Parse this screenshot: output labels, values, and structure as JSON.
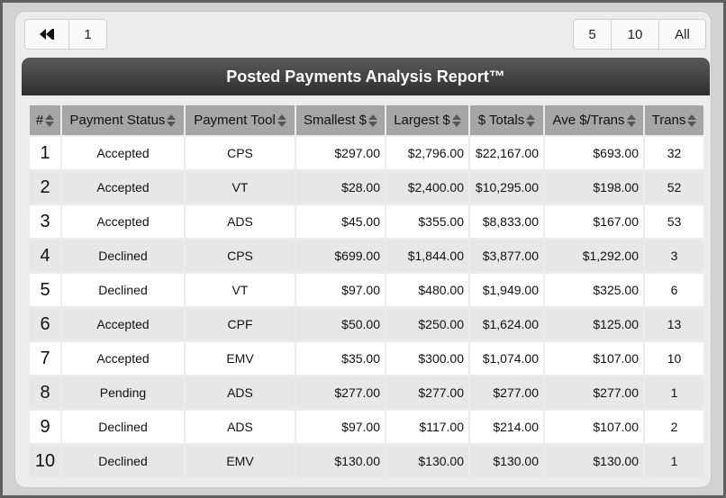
{
  "pager": {
    "first_label": "",
    "page_label": "1",
    "sizes": [
      "5",
      "10",
      "All"
    ]
  },
  "report": {
    "title": "Posted Payments Analysis Report™"
  },
  "table": {
    "columns": [
      "#",
      "Payment Status",
      "Payment Tool",
      "Smallest $",
      "Largest $",
      "$ Totals",
      "Ave $/Trans",
      "Trans"
    ],
    "rows": [
      [
        "1",
        "Accepted",
        "CPS",
        "$297.00",
        "$2,796.00",
        "$22,167.00",
        "$693.00",
        "32"
      ],
      [
        "2",
        "Accepted",
        "VT",
        "$28.00",
        "$2,400.00",
        "$10,295.00",
        "$198.00",
        "52"
      ],
      [
        "3",
        "Accepted",
        "ADS",
        "$45.00",
        "$355.00",
        "$8,833.00",
        "$167.00",
        "53"
      ],
      [
        "4",
        "Declined",
        "CPS",
        "$699.00",
        "$1,844.00",
        "$3,877.00",
        "$1,292.00",
        "3"
      ],
      [
        "5",
        "Declined",
        "VT",
        "$97.00",
        "$480.00",
        "$1,949.00",
        "$325.00",
        "6"
      ],
      [
        "6",
        "Accepted",
        "CPF",
        "$50.00",
        "$250.00",
        "$1,624.00",
        "$125.00",
        "13"
      ],
      [
        "7",
        "Accepted",
        "EMV",
        "$35.00",
        "$300.00",
        "$1,074.00",
        "$107.00",
        "10"
      ],
      [
        "8",
        "Pending",
        "ADS",
        "$277.00",
        "$277.00",
        "$277.00",
        "$277.00",
        "1"
      ],
      [
        "9",
        "Declined",
        "ADS",
        "$97.00",
        "$117.00",
        "$214.00",
        "$107.00",
        "2"
      ],
      [
        "10",
        "Declined",
        "EMV",
        "$130.00",
        "$130.00",
        "$130.00",
        "$130.00",
        "1"
      ]
    ]
  },
  "icons": {
    "first_page": "double-chevron-left-icon",
    "sort": "sort-up-down-icon"
  },
  "colors": {
    "title_bar": "#3d3d3d",
    "header_bg": "#a6a6a6",
    "row_alt": "#e7e7e7"
  }
}
